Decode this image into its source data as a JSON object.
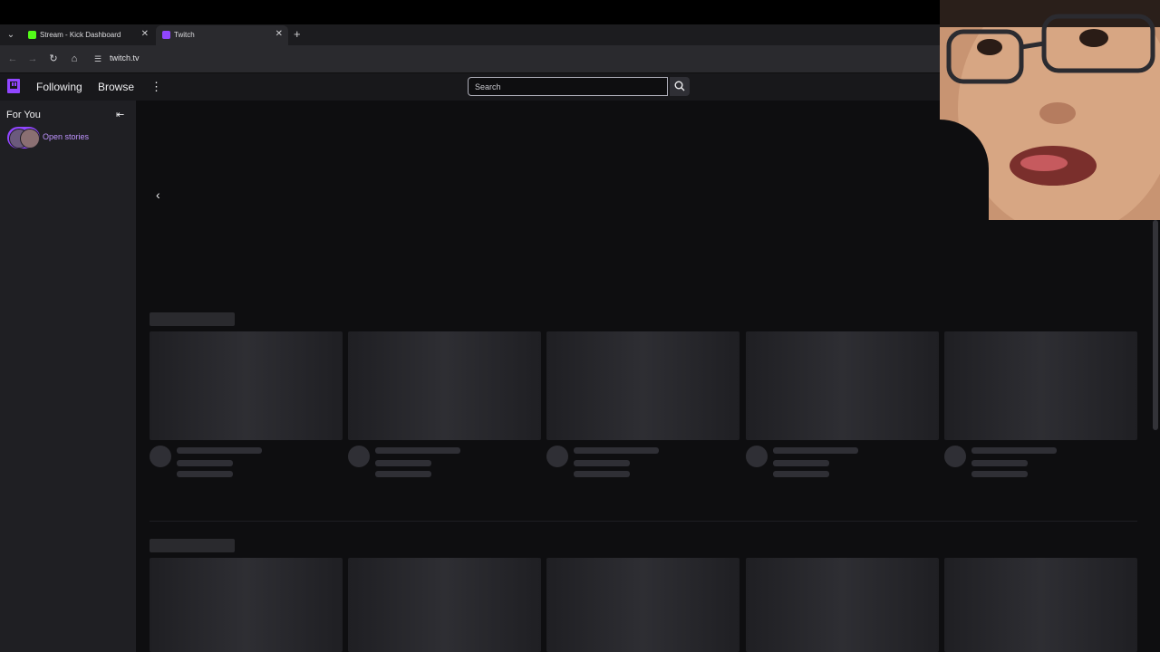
{
  "browser": {
    "tabs": [
      {
        "title": "Stream - Kick Dashboard",
        "favicon": "kick-icon",
        "color": "#53fc18",
        "active": false
      },
      {
        "title": "Twitch",
        "favicon": "twitch-icon",
        "color": "#9146ff",
        "active": true
      }
    ],
    "url": "twitch.tv"
  },
  "header": {
    "nav_following": "Following",
    "nav_browse": "Browse",
    "search_placeholder": "Search",
    "brand_color": "#9146ff"
  },
  "sidebar": {
    "section_title": "For You",
    "open_stories": "Open stories"
  },
  "main": {
    "shelves": [
      {
        "cards": 5,
        "loading": true
      },
      {
        "cards": 5,
        "loading": true
      }
    ]
  }
}
